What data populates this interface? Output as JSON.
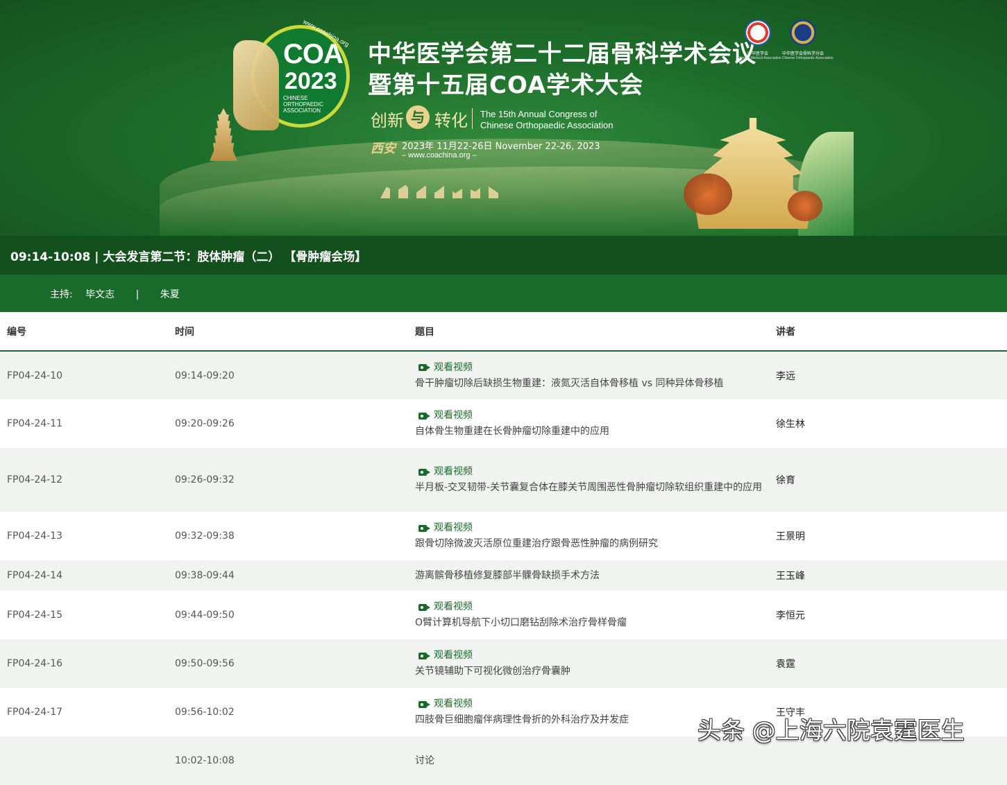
{
  "banner": {
    "logo_url": "www.coachina.org",
    "logo_coa": "COA",
    "logo_year": "2023",
    "logo_sub": "CHINESE ORTHOPAEDIC ASSOCIATION",
    "title_line1": "中华医学会第二十二届骨科学术会议",
    "title_line2": "暨第十五届COA学术大会",
    "theme_left": "创新",
    "theme_mid": "与",
    "theme_right": "转化",
    "theme_en_line1": "The 15th Annual Congress of",
    "theme_en_line2": "Chinese Orthopaedic Association",
    "city": "西安",
    "dates": "2023年 11月22-26日  November 22-26, 2023",
    "url": "– www.coachina.org –",
    "org1_name": "中华医学会",
    "org1_en": "Chinese Medical Association",
    "org2_name": "中华医学会骨科学分会",
    "org2_en": "Chinese Orthopaedic Association",
    "colors": {
      "green_dark": "#14501e",
      "green": "#1a6a2b",
      "gold": "#e9d28e"
    }
  },
  "session": {
    "title": "09:14-10:08 | 大会发言第二节：肢体肿瘤（二）  【骨肿瘤会场】",
    "host_label": "主持:",
    "host1": "毕文志",
    "separator": "|",
    "host2": "朱夏"
  },
  "table": {
    "headers": {
      "id": "编号",
      "time": "时间",
      "topic": "题目",
      "speaker": "讲者"
    },
    "video_label": "观看视频",
    "rows": [
      {
        "id": "FP04-24-10",
        "time": "09:14-09:20",
        "has_video": true,
        "topic": "骨干肿瘤切除后缺损生物重建：液氮灭活自体骨移植 vs 同种异体骨移植",
        "speaker": "李远"
      },
      {
        "id": "FP04-24-11",
        "time": "09:20-09:26",
        "has_video": true,
        "topic": "自体骨生物重建在长骨肿瘤切除重建中的应用",
        "speaker": "徐生林"
      },
      {
        "id": "FP04-24-12",
        "time": "09:26-09:32",
        "has_video": true,
        "topic": "半月板-交叉韧带-关节囊复合体在膝关节周围恶性骨肿瘤切除软组织重建中的应用",
        "speaker": "徐育"
      },
      {
        "id": "FP04-24-13",
        "time": "09:32-09:38",
        "has_video": true,
        "topic": "跟骨切除微波灭活原位重建治疗跟骨恶性肿瘤的病例研究",
        "speaker": "王景明"
      },
      {
        "id": "FP04-24-14",
        "time": "09:38-09:44",
        "has_video": false,
        "topic": "游离髌骨移植修复膝部半髁骨缺损手术方法",
        "speaker": "王玉峰"
      },
      {
        "id": "FP04-24-15",
        "time": "09:44-09:50",
        "has_video": true,
        "topic": "O臂计算机导航下小切口磨钻刮除术治疗骨样骨瘤",
        "speaker": "李恒元"
      },
      {
        "id": "FP04-24-16",
        "time": "09:50-09:56",
        "has_video": true,
        "topic": "关节镜辅助下可视化微创治疗骨囊肿",
        "speaker": "袁霆"
      },
      {
        "id": "FP04-24-17",
        "time": "09:56-10:02",
        "has_video": true,
        "topic": "四肢骨巨细胞瘤伴病理性骨折的外科治疗及并发症",
        "speaker": "王守丰"
      },
      {
        "id": "",
        "time": "10:02-10:08",
        "has_video": false,
        "topic": "讨论",
        "speaker": ""
      }
    ]
  },
  "watermark": "头条 @上海六院袁霆医生"
}
